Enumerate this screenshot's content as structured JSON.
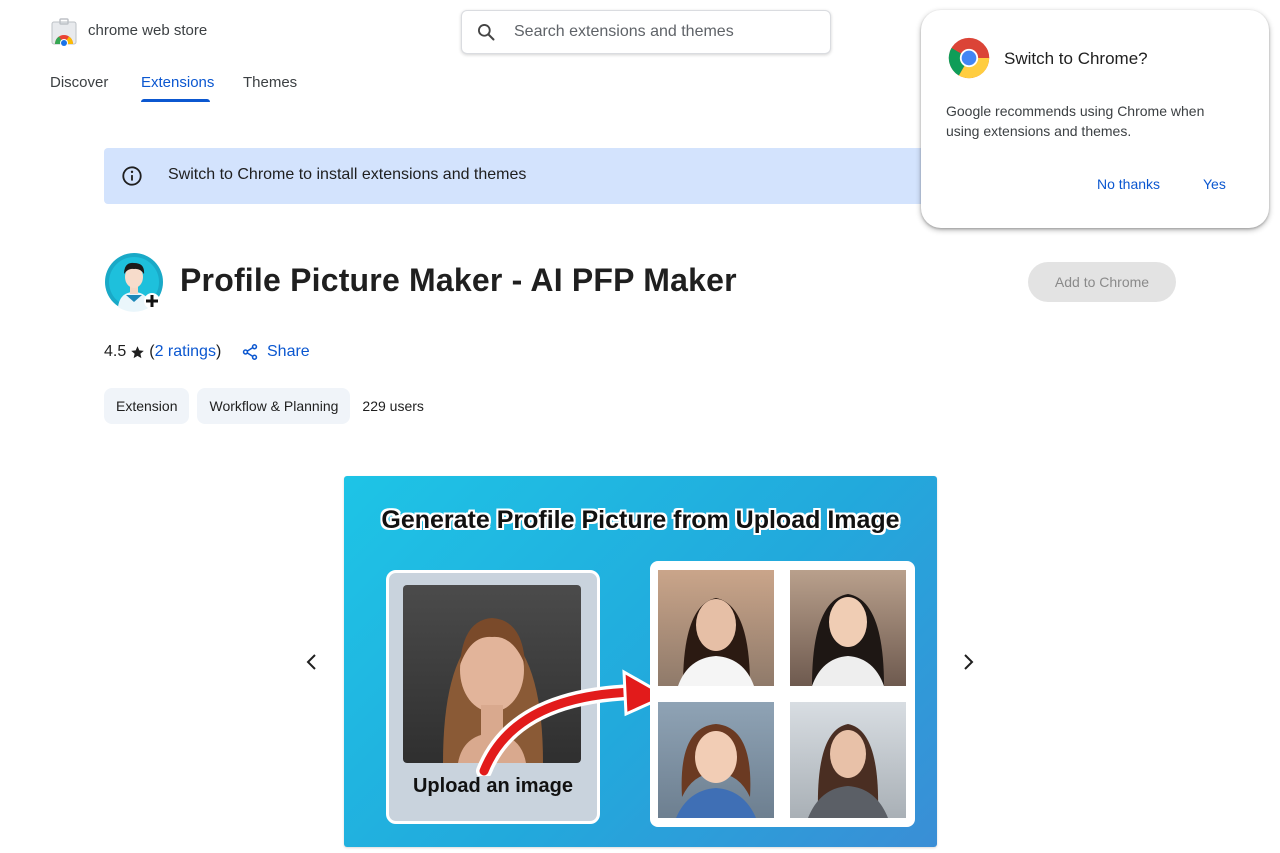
{
  "header": {
    "brand": "chrome web store",
    "search": {
      "placeholder": "Search extensions and themes"
    }
  },
  "nav": {
    "tabs": [
      {
        "label": "Discover",
        "active": false
      },
      {
        "label": "Extensions",
        "active": true
      },
      {
        "label": "Themes",
        "active": false
      }
    ]
  },
  "banner": {
    "text": "Switch to Chrome to install extensions and themes"
  },
  "popup": {
    "title": "Switch to Chrome?",
    "body": "Google recommends using Chrome when using extensions and themes.",
    "no_label": "No thanks",
    "yes_label": "Yes"
  },
  "extension": {
    "title": "Profile Picture Maker - AI PFP Maker",
    "add_label": "Add to Chrome",
    "rating": "4.5",
    "ratings_link": "2 ratings",
    "share_label": "Share",
    "chips": [
      "Extension",
      "Workflow & Planning"
    ],
    "users": "229 users"
  },
  "slide": {
    "title": "Generate Profile Picture from Upload Image",
    "upload_label": "Upload an image"
  },
  "icons": [
    "chrome-web-store-logo",
    "search-icon",
    "info-icon",
    "chrome-logo-icon",
    "star-icon",
    "share-icon",
    "chevron-left-icon",
    "chevron-right-icon"
  ],
  "colors": {
    "accent": "#0b57d0",
    "banner_bg": "#d3e3fd",
    "chip_bg": "#f0f4f9",
    "disabled_btn": "#e3e3e3"
  }
}
